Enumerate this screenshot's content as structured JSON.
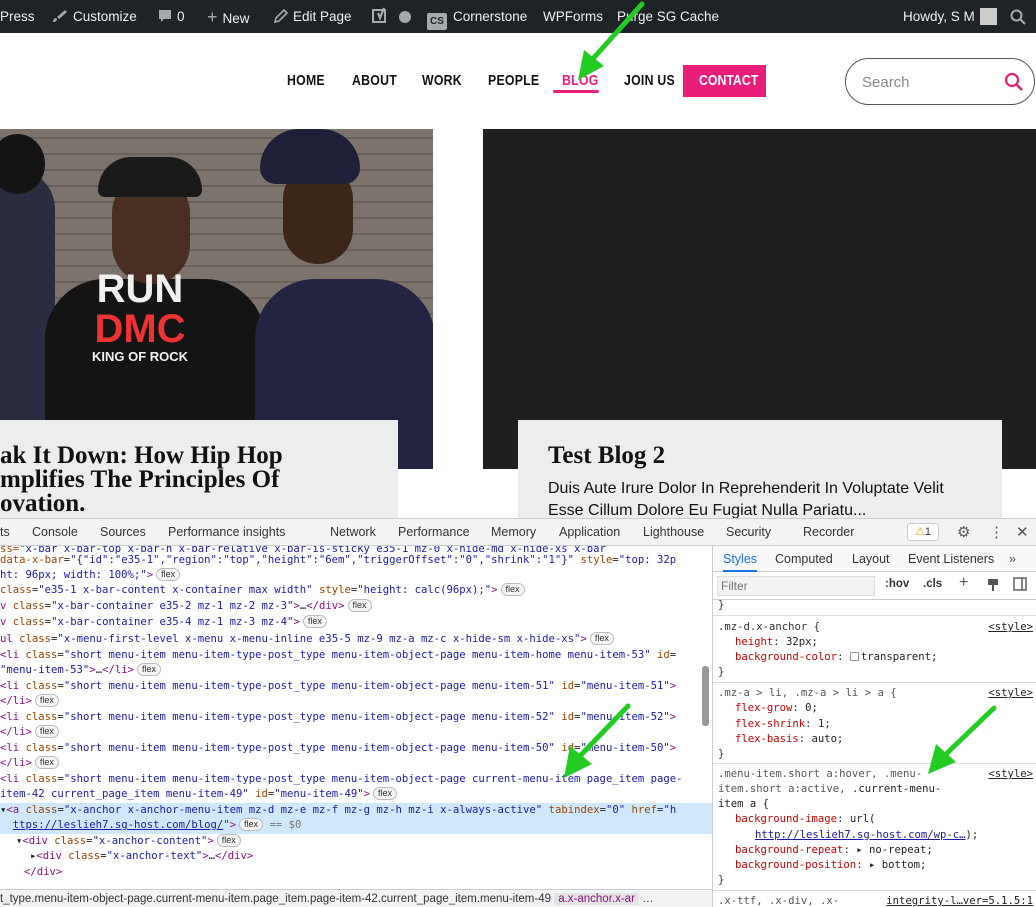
{
  "adminbar": {
    "site": "Press",
    "customize": "Customize",
    "comments": "0",
    "new": "New",
    "edit_page": "Edit Page",
    "cornerstone_badge": "CS",
    "cornerstone": "Cornerstone",
    "wpforms": "WPForms",
    "purge": "Purge SG Cache",
    "howdy": "Howdy, S M"
  },
  "nav": {
    "home": "HOME",
    "about": "ABOUT",
    "work": "WORK",
    "people": "PEOPLE",
    "blog": "BLOG",
    "join": "JOIN US",
    "contact": "CONTACT"
  },
  "search": {
    "placeholder": "Search"
  },
  "posts": [
    {
      "title_lines": [
        "ak It Down: How Hip Hop",
        "mplifies The Principles Of",
        "ovation."
      ],
      "photo_text": {
        "run": "RUN",
        "dmc": "DMC",
        "king": "KING OF ROCK"
      }
    },
    {
      "title": "Test Blog 2",
      "excerpt_lines": [
        "Duis Aute Irure Dolor In Reprehenderit In Voluptate Velit",
        "Esse Cillum Dolore Eu Fugiat Nulla Pariatu..."
      ]
    }
  ],
  "devtools": {
    "tabs": [
      "ts",
      "Console",
      "Sources",
      "Performance insights",
      "Network",
      "Performance",
      "Memory",
      "Application",
      "Lighthouse",
      "Security",
      "Recorder"
    ],
    "warning_count": "1",
    "styles_tabs": [
      "Styles",
      "Computed",
      "Layout",
      "Event Listeners"
    ],
    "filter_placeholder": "Filter",
    "hov": ":hov",
    "cls": ".cls",
    "breadcrumb": "t_type.menu-item-object-page.current-menu-item.page_item.page-item-42.current_page_item.menu-item-49",
    "breadcrumb_active": "a.x-anchor.x-ar",
    "breadcrumb_more": "…",
    "flex": "flex",
    "dollar": "== $0"
  },
  "colors": {
    "accent": "#e91e7a",
    "adminbar": "#1d2327",
    "arrow": "#22cc22"
  }
}
